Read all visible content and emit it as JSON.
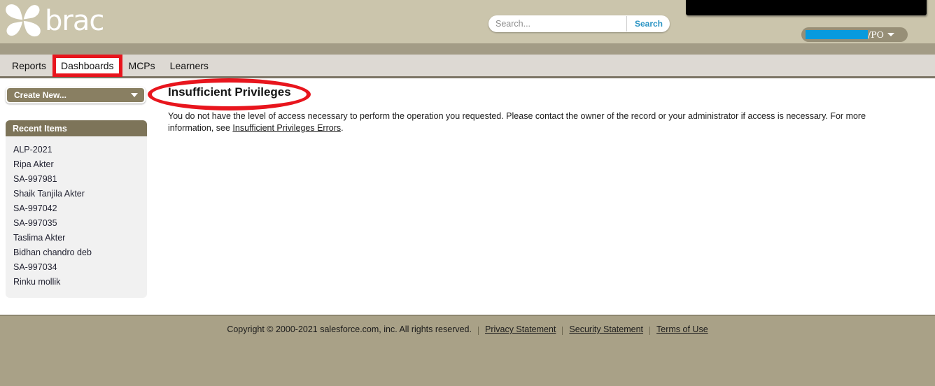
{
  "header": {
    "logo_text": "brac",
    "logo_icon": "brac-pinwheel-logo",
    "search": {
      "placeholder": "Search...",
      "value": "",
      "button_label": "Search"
    },
    "user_menu": {
      "redacted": true,
      "name_suffix": "/PO",
      "caret_icon": "chevron-down-icon"
    },
    "top_redaction": {
      "redacted": true
    },
    "colors": {
      "header_bg": "#cbc5ac",
      "header_band": "#a39c86",
      "search_button_text": "#2a94c4",
      "user_pill_bg": "#978f77",
      "user_redaction": "#079ade"
    }
  },
  "navigation": {
    "tabs": [
      {
        "label": "Reports",
        "highlighted": false
      },
      {
        "label": "Dashboards",
        "highlighted": true
      },
      {
        "label": "MCPs",
        "highlighted": false
      },
      {
        "label": "Learners",
        "highlighted": false
      }
    ],
    "colors": {
      "tabbar_bg": "#ddd9d3",
      "tabbar_border": "#7c7565",
      "highlight": "#e8151d"
    }
  },
  "sidebar": {
    "create_new": {
      "label": "Create New...",
      "caret_icon": "chevron-down-icon"
    },
    "recent_items": {
      "title": "Recent Items",
      "items": [
        {
          "label": "ALP-2021"
        },
        {
          "label": "Ripa Akter"
        },
        {
          "label": "SA-997981"
        },
        {
          "label": "Shaik Tanjila Akter"
        },
        {
          "label": "SA-997042"
        },
        {
          "label": "SA-997035"
        },
        {
          "label": "Taslima Akter"
        },
        {
          "label": "Bidhan chandro deb"
        },
        {
          "label": "SA-997034"
        },
        {
          "label": "Rinku mollik"
        }
      ]
    }
  },
  "main": {
    "title": "Insufficient Privileges",
    "message_prefix": "You do not have the level of access necessary to perform the operation you requested. Please contact the owner of the record or your administrator if access is necessary. For more information, see ",
    "message_link": "Insufficient Privileges Errors",
    "message_suffix": "."
  },
  "annotations": {
    "ellipse_color": "#e8151d",
    "ellipse_target": "Insufficient Privileges",
    "rect_color": "#e8151d",
    "rect_target": "Dashboards"
  },
  "footer": {
    "copyright": "Copyright © 2000-2021 salesforce.com, inc. All rights reserved.",
    "links": [
      {
        "label": "Privacy Statement"
      },
      {
        "label": "Security Statement"
      },
      {
        "label": "Terms of Use"
      }
    ]
  }
}
